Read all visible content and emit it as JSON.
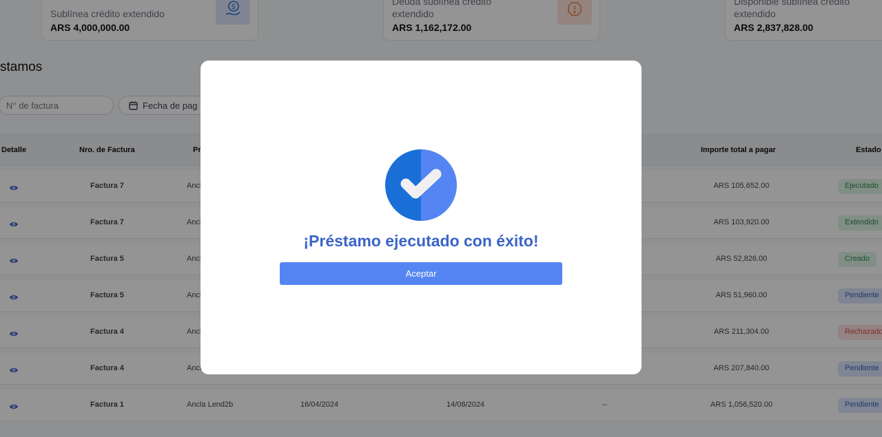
{
  "cards": [
    {
      "label": "Sublínea crédito extendido",
      "value": "ARS 4,000,000.00",
      "icon": "hand-coin-icon",
      "color": "#3b6fd8"
    },
    {
      "label": "Deuda sublínea crédito extendido",
      "value": "ARS 1,162,172.00",
      "icon": "warning-octagon-icon",
      "color": "#f28c5a"
    },
    {
      "label": "Disponible sublínea crédito extendido",
      "value": "ARS 2,837,828.00"
    }
  ],
  "section_title": "stamos",
  "filters": {
    "invoice_placeholder": "N° de factura",
    "date_label": "Fecha de pag"
  },
  "table": {
    "columns": {
      "detail": "Detalle",
      "invoice": "Nro. de Factura",
      "provider": "Pr",
      "total": "Importe total a pagar",
      "status": "Estado"
    },
    "rows": [
      {
        "invoice": "Factura 7",
        "provider": "Ancla",
        "start": "",
        "end": "",
        "mid": "",
        "total": "ARS 105,652.00",
        "status": "Ejecutado"
      },
      {
        "invoice": "Factura 7",
        "provider": "Ancla",
        "start": "",
        "end": "",
        "mid": "",
        "total": "ARS 103,920.00",
        "status": "Extendido"
      },
      {
        "invoice": "Factura 5",
        "provider": "Ancla",
        "start": "",
        "end": "",
        "mid": "",
        "total": "ARS 52,826.00",
        "status": "Creado"
      },
      {
        "invoice": "Factura 5",
        "provider": "Ancla",
        "start": "",
        "end": "",
        "mid": "",
        "total": "ARS 51,960.00",
        "status": "Pendiente"
      },
      {
        "invoice": "Factura 4",
        "provider": "Ancla",
        "start": "",
        "end": "",
        "mid": "",
        "total": "ARS 211,304.00",
        "status": "Rechazado"
      },
      {
        "invoice": "Factura 4",
        "provider": "Ancla",
        "start": "",
        "end": "",
        "mid": "",
        "total": "ARS 207,840.00",
        "status": "Pendiente"
      },
      {
        "invoice": "Factura 1",
        "provider": "Ancla Lend2b",
        "start": "16/04/2024",
        "end": "14/08/2024",
        "mid": "--",
        "total": "ARS 1,056,520.00",
        "status": "Pendiente"
      }
    ],
    "status_colors": {
      "Ejecutado": {
        "bg": "#def5e6",
        "fg": "#2f8a50"
      },
      "Extendido": {
        "bg": "#def5e6",
        "fg": "#2f8a50"
      },
      "Creado": {
        "bg": "#def5e6",
        "fg": "#2f8a50"
      },
      "Pendiente": {
        "bg": "#dbe5fb",
        "fg": "#3a5fc0"
      },
      "Rechazado": {
        "bg": "#fde2e2",
        "fg": "#d9534f"
      }
    }
  },
  "modal": {
    "title": "¡Préstamo ejecutado con éxito!",
    "button_label": "Aceptar",
    "icon": "check-circle-icon",
    "icon_colors": {
      "left": "#1a6fd6",
      "right": "#5585f2"
    }
  }
}
